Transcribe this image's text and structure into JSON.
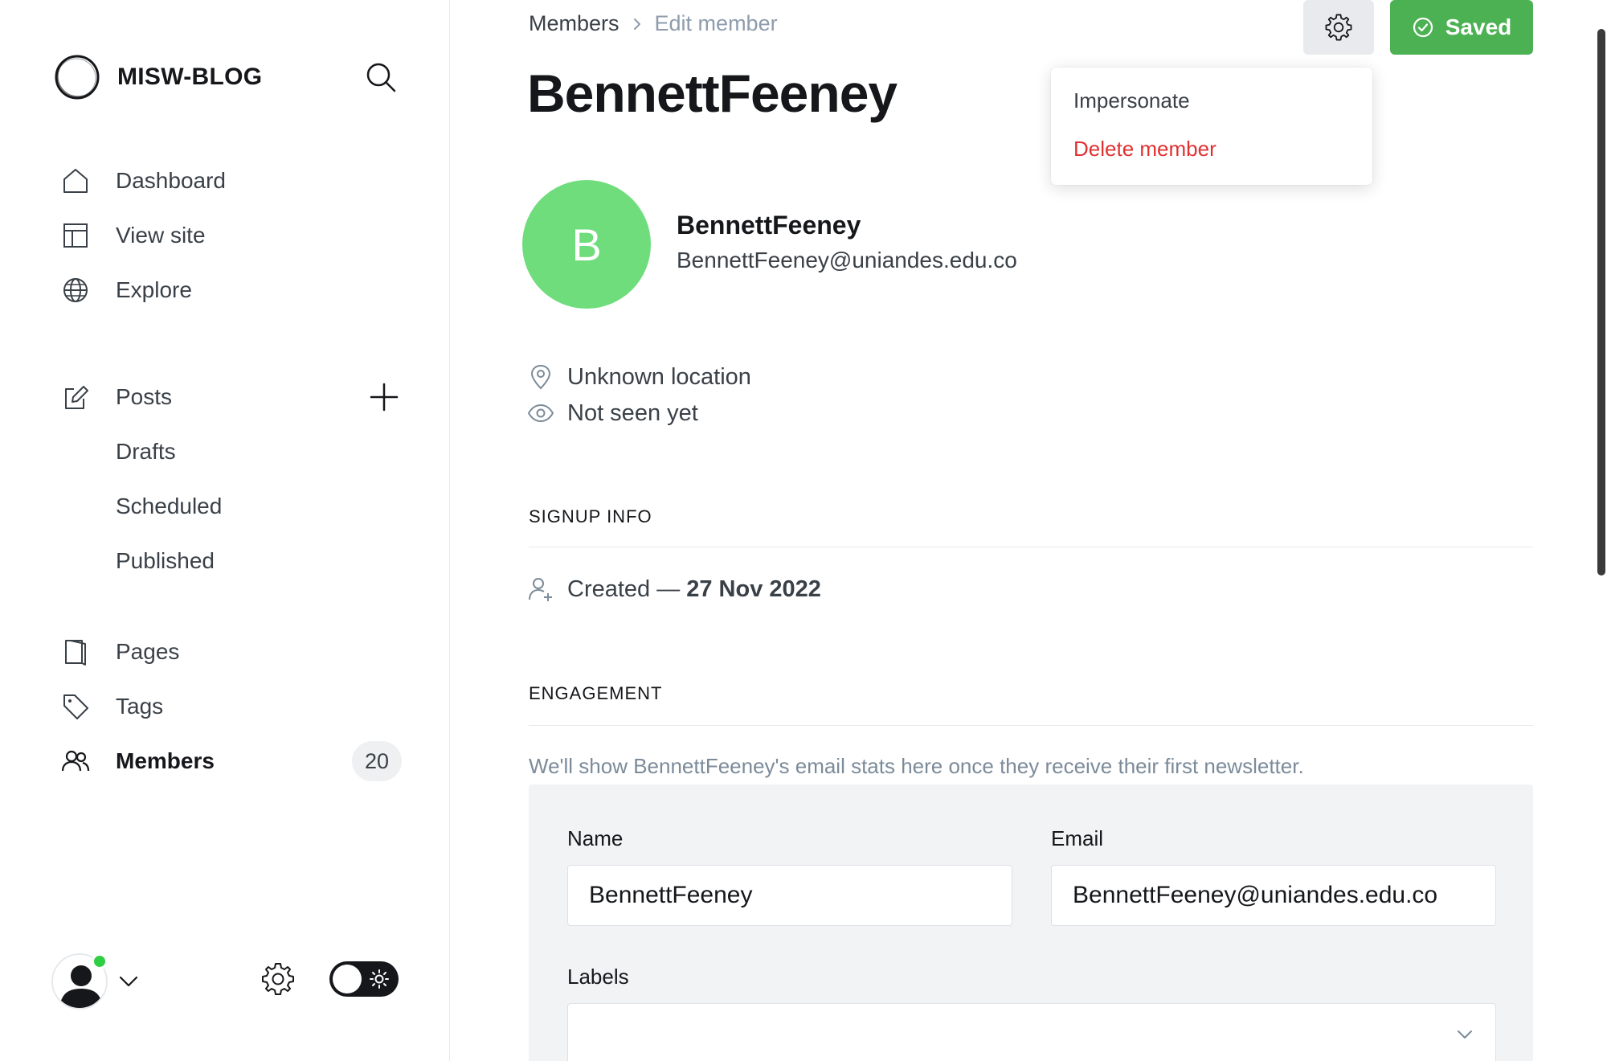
{
  "sidebar": {
    "brand": "MISW-BLOG",
    "nav": {
      "dashboard": "Dashboard",
      "view_site": "View site",
      "explore": "Explore",
      "posts": "Posts",
      "drafts": "Drafts",
      "scheduled": "Scheduled",
      "published": "Published",
      "pages": "Pages",
      "tags": "Tags",
      "members": "Members",
      "members_count": "20"
    }
  },
  "header": {
    "breadcrumb_parent": "Members",
    "breadcrumb_current": "Edit member",
    "title": "BennettFeeney",
    "saved_label": "Saved"
  },
  "dropdown": {
    "impersonate": "Impersonate",
    "delete": "Delete member"
  },
  "member": {
    "initial": "B",
    "name": "BennettFeeney",
    "email": "BennettFeeney@uniandes.edu.co",
    "location": "Unknown location",
    "seen": "Not seen yet"
  },
  "signup": {
    "section_title": "SIGNUP INFO",
    "created_prefix": "Created —",
    "created_date": "27 Nov 2022"
  },
  "engagement": {
    "section_title": "ENGAGEMENT",
    "note": "We'll show BennettFeeney's email stats here once they receive their first newsletter."
  },
  "form": {
    "name_label": "Name",
    "name_value": "BennettFeeney",
    "email_label": "Email",
    "email_value": "BennettFeeney@uniandes.edu.co",
    "labels_label": "Labels",
    "labels_value": ""
  },
  "colors": {
    "accent_green": "#4cb152",
    "avatar_green": "#6fdd7c",
    "danger_red": "#e03131",
    "status_dot": "#30cf43"
  }
}
